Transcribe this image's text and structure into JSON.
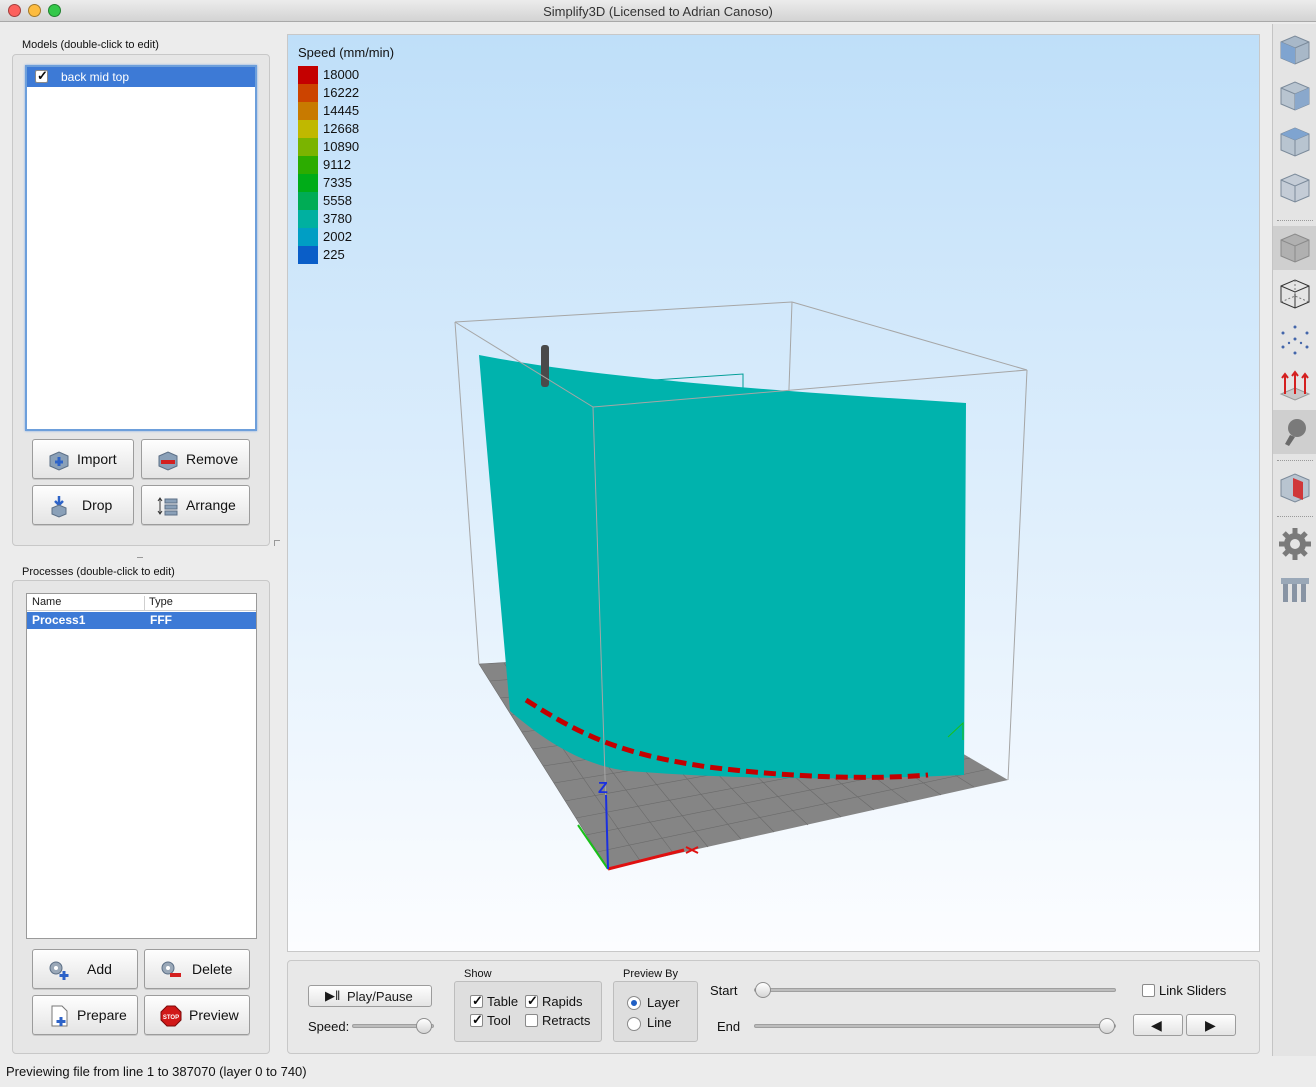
{
  "window": {
    "title": "Simplify3D (Licensed to Adrian Canoso)"
  },
  "models": {
    "label": "Models (double-click to edit)",
    "items": [
      {
        "name": "back mid top",
        "checked": true
      }
    ],
    "buttons": {
      "import": "Import",
      "remove": "Remove",
      "drop": "Drop",
      "arrange": "Arrange"
    }
  },
  "processes": {
    "label": "Processes (double-click to edit)",
    "columns": [
      "Name",
      "Type"
    ],
    "rows": [
      {
        "name": "Process1",
        "type": "FFF"
      }
    ],
    "buttons": {
      "add": "Add",
      "delete": "Delete",
      "prepare": "Prepare",
      "preview": "Preview"
    }
  },
  "legend": {
    "title": "Speed (mm/min)",
    "entries": [
      {
        "value": "18000",
        "color": "#c40000"
      },
      {
        "value": "16222",
        "color": "#cc4400"
      },
      {
        "value": "14445",
        "color": "#c87a00"
      },
      {
        "value": "12668",
        "color": "#c0b800"
      },
      {
        "value": "10890",
        "color": "#7ab400"
      },
      {
        "value": "9112",
        "color": "#2cac00"
      },
      {
        "value": "7335",
        "color": "#00ac18"
      },
      {
        "value": "5558",
        "color": "#00ac55"
      },
      {
        "value": "3780",
        "color": "#00b0a0"
      },
      {
        "value": "2002",
        "color": "#009ec4"
      },
      {
        "value": "225",
        "color": "#0a5ec8"
      }
    ]
  },
  "scene": {
    "axis_z_label": "Z",
    "model_color": "#00b3ad",
    "bed_color": "#858585",
    "x_axis_color": "#e01010",
    "y_axis_color": "#19c019",
    "z_axis_color": "#1a30e0"
  },
  "toolbar_icons": [
    "front-view-icon",
    "back-view-icon",
    "left-view-icon",
    "right-view-icon",
    "solid-mode-icon",
    "wireframe-mode-icon",
    "point-mode-icon",
    "axes-icon",
    "lighting-icon",
    "cross-section-icon",
    "settings-gear-icon",
    "supports-icon"
  ],
  "preview": {
    "play_pause": "Play/Pause",
    "speed_label": "Speed:",
    "speed_level": 0.88,
    "show": {
      "label": "Show",
      "table": "Table",
      "rapids": "Rapids",
      "tool": "Tool",
      "retracts": "Retracts",
      "table_checked": true,
      "rapids_checked": true,
      "tool_checked": true,
      "retracts_checked": false
    },
    "preview_by": {
      "label": "Preview By",
      "layer": "Layer",
      "line": "Line",
      "selected": "Layer"
    },
    "start_label": "Start",
    "end_label": "End",
    "start_value": 0,
    "end_value": 740,
    "link_sliders": "Link Sliders",
    "link_checked": false
  },
  "status": "Previewing file from line 1 to 387070 (layer 0 to 740)"
}
